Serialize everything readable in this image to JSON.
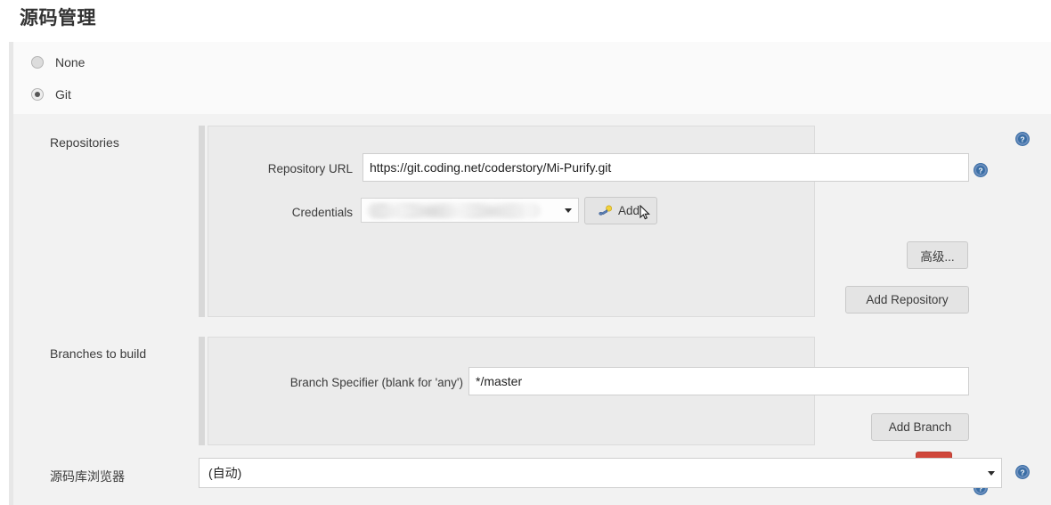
{
  "page": {
    "title": "源码管理"
  },
  "scm_type": {
    "options": [
      {
        "label": "None",
        "selected": false
      },
      {
        "label": "Git",
        "selected": true
      }
    ]
  },
  "repositories": {
    "section_label": "Repositories",
    "repository_url": {
      "label": "Repository URL",
      "value": "https://git.coding.net/coderstory/Mi-Purify.git"
    },
    "credentials": {
      "label": "Credentials",
      "value": "",
      "redacted": true,
      "add_button_label": "Add",
      "add_button_icon": "key-icon"
    },
    "advanced_button_label": "高级...",
    "add_repository_button_label": "Add Repository"
  },
  "branches": {
    "section_label": "Branches to build",
    "delete_button_label": "X",
    "branch_specifier": {
      "label": "Branch Specifier (blank for 'any')",
      "value": "*/master"
    },
    "add_branch_button_label": "Add Branch"
  },
  "repository_browser": {
    "label": "源码库浏览器",
    "selected_option": "(自动)"
  },
  "help_icons": {
    "name": "help-icon",
    "glyph": "?"
  },
  "colors": {
    "delete_red": "#d0473b",
    "help_blue": "#3a6ea5",
    "panel_bg": "#ebebeb",
    "form_bg": "#f2f2f2",
    "button_bg": "#e4e4e4"
  }
}
